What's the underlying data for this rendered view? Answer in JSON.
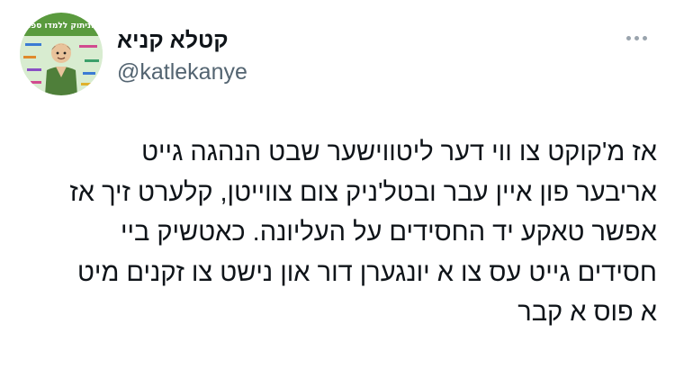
{
  "author": {
    "display_name": "קטלא קניא",
    "handle": "@katlekanye",
    "avatar_text": "הניתוק ללמדו ספר"
  },
  "tweet": {
    "lines": [
      "אז מ'קוקט צו ווי דער ליטווישער שבט הנהגה גייט",
      "אריבער פון איין עבר ובטל'ניק צום צווייטן, קלערט זיך אז",
      "אפשר טאקע יד החסידים על העליונה. כאטשיק ביי",
      "חסידים גייט עס צו א יונגערן דור און נישט צו זקנים מיט",
      "א פוס א קבר"
    ]
  },
  "icons": {
    "more": "more-horizontal-icon"
  },
  "colors": {
    "text_primary": "#0f1419",
    "text_secondary": "#536471",
    "icon_gray": "#9aa4ad",
    "background": "#ffffff"
  }
}
